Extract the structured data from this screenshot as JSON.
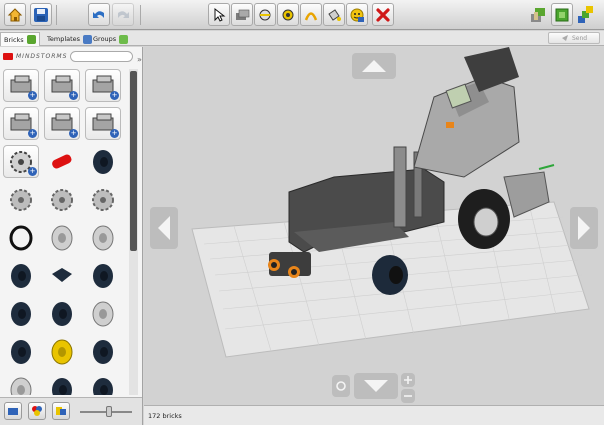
{
  "toolbar": {
    "buttons": [
      {
        "name": "home-button",
        "icon": "home-icon"
      },
      {
        "name": "save-button",
        "icon": "floppy-disk-icon"
      },
      {
        "name": "undo-button",
        "icon": "undo-arrow-icon"
      },
      {
        "name": "redo-button",
        "icon": "redo-arrow-icon"
      },
      {
        "name": "select-tool-button",
        "icon": "cursor-arrow-icon"
      },
      {
        "name": "clone-tool-button",
        "icon": "clone-brick-icon"
      },
      {
        "name": "hinge-tool-button",
        "icon": "hinge-icon"
      },
      {
        "name": "hinge-align-tool-button",
        "icon": "hinge-align-icon"
      },
      {
        "name": "flex-tool-button",
        "icon": "flex-icon"
      },
      {
        "name": "paint-tool-button",
        "icon": "paint-bucket-icon"
      },
      {
        "name": "hide-tool-button",
        "icon": "hide-icon"
      },
      {
        "name": "delete-tool-button",
        "icon": "red-x-icon"
      },
      {
        "name": "build-mode-button",
        "icon": "build-mode-icon"
      },
      {
        "name": "view-mode-button",
        "icon": "view-mode-icon"
      },
      {
        "name": "instructions-mode-button",
        "icon": "instructions-mode-icon"
      }
    ]
  },
  "tabs": [
    {
      "label": "Bricks",
      "icon": "green-brick-icon",
      "active": true
    },
    {
      "label": "Templates",
      "icon": "templates-icon",
      "active": false
    },
    {
      "label": "Groups",
      "icon": "groups-icon",
      "active": false
    }
  ],
  "send": {
    "label": "Send",
    "icon": "send-icon"
  },
  "palette": {
    "brand": "MINDSTORMS",
    "search_placeholder": "",
    "items": [
      {
        "icon": "nxt-brick-icon",
        "boxed": true
      },
      {
        "icon": "servo-motor-icon",
        "boxed": true
      },
      {
        "icon": "ultrasonic-sensor-icon",
        "boxed": true
      },
      {
        "icon": "touch-sensor-icon",
        "boxed": true
      },
      {
        "icon": "light-sensor-icon",
        "boxed": true
      },
      {
        "icon": "sound-sensor-icon",
        "boxed": true
      },
      {
        "icon": "gear-wheel-icon",
        "boxed": true
      },
      {
        "icon": "red-connector-icon",
        "boxed": false
      },
      {
        "icon": "tire-icon",
        "boxed": false
      },
      {
        "icon": "gear-icon",
        "boxed": false
      },
      {
        "icon": "gear-icon",
        "boxed": false
      },
      {
        "icon": "gear-icon",
        "boxed": false
      },
      {
        "icon": "rubber-band-icon",
        "boxed": false
      },
      {
        "icon": "rim-icon",
        "boxed": false
      },
      {
        "icon": "rim-icon",
        "boxed": false
      },
      {
        "icon": "tire-icon",
        "boxed": false
      },
      {
        "icon": "beam-piece-icon",
        "boxed": false
      },
      {
        "icon": "tire-icon",
        "boxed": false
      },
      {
        "icon": "tire-icon",
        "boxed": false
      },
      {
        "icon": "tire-icon",
        "boxed": false
      },
      {
        "icon": "rim-icon",
        "boxed": false
      },
      {
        "icon": "tire-icon",
        "boxed": false
      },
      {
        "icon": "yellow-rim-icon",
        "boxed": false
      },
      {
        "icon": "tire-icon",
        "boxed": false
      },
      {
        "icon": "rim-icon",
        "boxed": false
      },
      {
        "icon": "tire-icon",
        "boxed": false
      },
      {
        "icon": "tire-icon",
        "boxed": false
      }
    ]
  },
  "footer_tools": [
    {
      "name": "view-small-bricks-button",
      "icon": "small-bricks-icon"
    },
    {
      "name": "color-filter-button",
      "icon": "color-palette-icon"
    },
    {
      "name": "group-view-button",
      "icon": "brick-group-icon"
    }
  ],
  "zoom_slider_level": 0.55,
  "status": {
    "bricks_label": "172 bricks"
  },
  "colors": {
    "brand_red": "#dd1111",
    "plus_blue": "#2f63b8",
    "accent_yellow": "#e9c400"
  }
}
